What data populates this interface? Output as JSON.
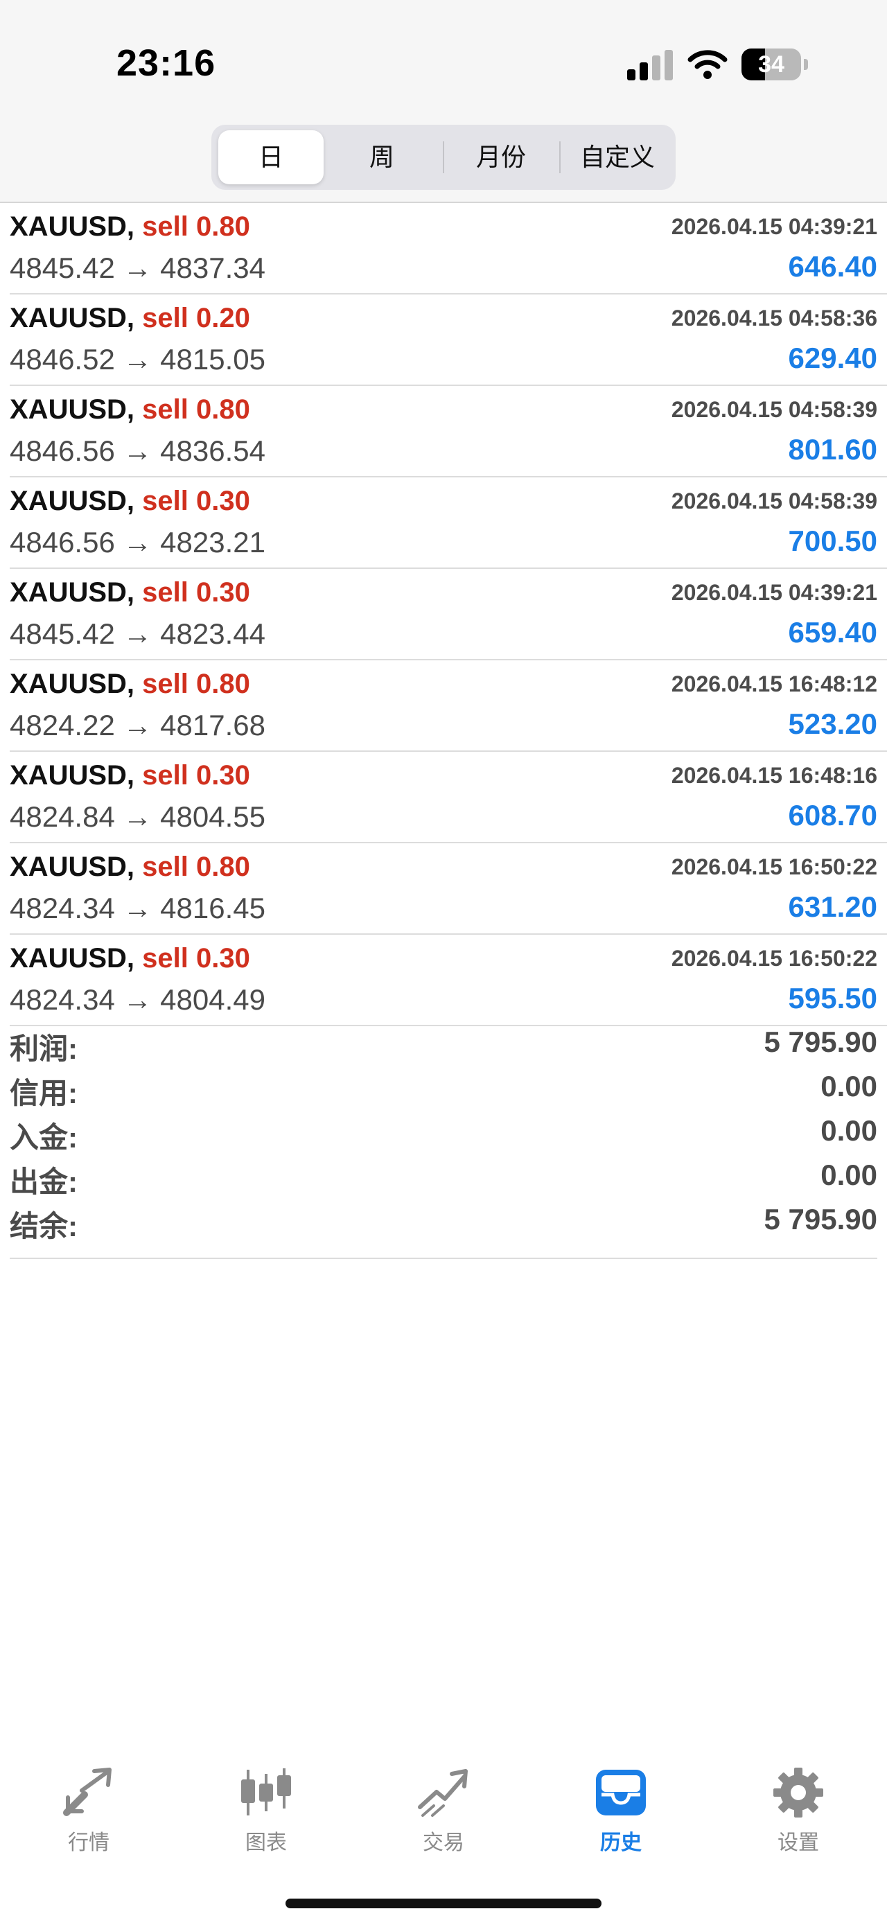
{
  "status_bar": {
    "time": "23:16",
    "battery": "34"
  },
  "period_tabs": [
    {
      "label": "日",
      "active": true
    },
    {
      "label": "周",
      "active": false
    },
    {
      "label": "月份",
      "active": false
    },
    {
      "label": "自定义",
      "active": false
    }
  ],
  "trades": [
    {
      "symbol": "XAUUSD,",
      "type": "sell 0.80",
      "datetime": "2026.04.15 04:39:21",
      "open": "4845.42",
      "close": "4837.34",
      "arrow": "→",
      "profit": "646.40"
    },
    {
      "symbol": "XAUUSD,",
      "type": "sell 0.20",
      "datetime": "2026.04.15 04:58:36",
      "open": "4846.52",
      "close": "4815.05",
      "arrow": "→",
      "profit": "629.40"
    },
    {
      "symbol": "XAUUSD,",
      "type": "sell 0.80",
      "datetime": "2026.04.15 04:58:39",
      "open": "4846.56",
      "close": "4836.54",
      "arrow": "→",
      "profit": "801.60"
    },
    {
      "symbol": "XAUUSD,",
      "type": "sell 0.30",
      "datetime": "2026.04.15 04:58:39",
      "open": "4846.56",
      "close": "4823.21",
      "arrow": "→",
      "profit": "700.50"
    },
    {
      "symbol": "XAUUSD,",
      "type": "sell 0.30",
      "datetime": "2026.04.15 04:39:21",
      "open": "4845.42",
      "close": "4823.44",
      "arrow": "→",
      "profit": "659.40"
    },
    {
      "symbol": "XAUUSD,",
      "type": "sell 0.80",
      "datetime": "2026.04.15 16:48:12",
      "open": "4824.22",
      "close": "4817.68",
      "arrow": "→",
      "profit": "523.20"
    },
    {
      "symbol": "XAUUSD,",
      "type": "sell 0.30",
      "datetime": "2026.04.15 16:48:16",
      "open": "4824.84",
      "close": "4804.55",
      "arrow": "→",
      "profit": "608.70"
    },
    {
      "symbol": "XAUUSD,",
      "type": "sell 0.80",
      "datetime": "2026.04.15 16:50:22",
      "open": "4824.34",
      "close": "4816.45",
      "arrow": "→",
      "profit": "631.20"
    },
    {
      "symbol": "XAUUSD,",
      "type": "sell 0.30",
      "datetime": "2026.04.15 16:50:22",
      "open": "4824.34",
      "close": "4804.49",
      "arrow": "→",
      "profit": "595.50"
    }
  ],
  "summary": [
    {
      "label": "利润:",
      "value": "5 795.90"
    },
    {
      "label": "信用:",
      "value": "0.00"
    },
    {
      "label": "入金:",
      "value": "0.00"
    },
    {
      "label": "出金:",
      "value": "0.00"
    },
    {
      "label": "结余:",
      "value": "5 795.90"
    }
  ],
  "tabbar": [
    {
      "label": "行情",
      "icon": "quotes-icon",
      "active": false
    },
    {
      "label": "图表",
      "icon": "chart-icon",
      "active": false
    },
    {
      "label": "交易",
      "icon": "trade-icon",
      "active": false
    },
    {
      "label": "历史",
      "icon": "history-icon",
      "active": true
    },
    {
      "label": "设置",
      "icon": "settings-icon",
      "active": false
    }
  ],
  "colors": {
    "sell": "#d0301e",
    "profit": "#1a7ee6",
    "active_tab": "#1a7ee6",
    "inactive_tab": "#8a8a8a"
  }
}
